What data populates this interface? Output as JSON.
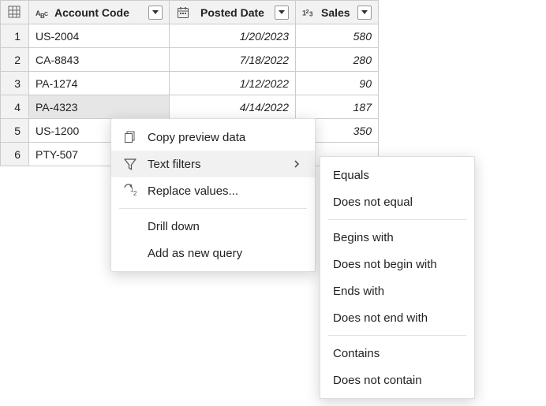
{
  "columns": {
    "account": "Account Code",
    "date": "Posted Date",
    "sales": "Sales"
  },
  "rows": [
    {
      "n": "1",
      "account": "US-2004",
      "date": "1/20/2023",
      "sales": "580"
    },
    {
      "n": "2",
      "account": "CA-8843",
      "date": "7/18/2022",
      "sales": "280"
    },
    {
      "n": "3",
      "account": "PA-1274",
      "date": "1/12/2022",
      "sales": "90"
    },
    {
      "n": "4",
      "account": "PA-4323",
      "date": "4/14/2022",
      "sales": "187"
    },
    {
      "n": "5",
      "account": "US-1200",
      "date": "",
      "sales": "350"
    },
    {
      "n": "6",
      "account": "PTY-507",
      "date": "",
      "sales": ""
    }
  ],
  "contextMenu": {
    "copy": "Copy preview data",
    "textFilters": "Text filters",
    "replace": "Replace values...",
    "drill": "Drill down",
    "addQuery": "Add as new query"
  },
  "filterMenu": {
    "equals": "Equals",
    "notEqual": "Does not equal",
    "begins": "Begins with",
    "notBegin": "Does not begin with",
    "ends": "Ends with",
    "notEnd": "Does not end with",
    "contains": "Contains",
    "notContain": "Does not contain"
  }
}
